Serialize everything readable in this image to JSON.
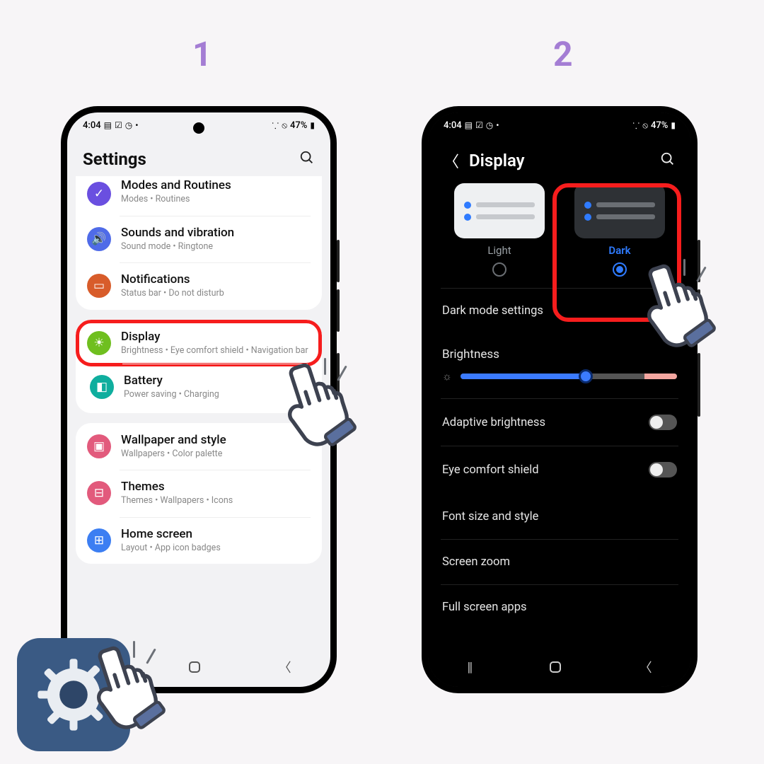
{
  "steps": {
    "one": "1",
    "two": "2"
  },
  "status": {
    "time": "4:04",
    "battery": "47%"
  },
  "screen1": {
    "title": "Settings",
    "rows": [
      {
        "title": "Modes and Routines",
        "sub": "Modes  •  Routines",
        "color": "#6a4fe0",
        "glyph": "✓"
      },
      {
        "title": "Sounds and vibration",
        "sub": "Sound mode  •  Ringtone",
        "color": "#4f6be8",
        "glyph": "🔊"
      },
      {
        "title": "Notifications",
        "sub": "Status bar  •  Do not disturb",
        "color": "#d85c2a",
        "glyph": "▭"
      },
      {
        "title": "Display",
        "sub": "Brightness  •  Eye comfort shield  •  Navigation bar",
        "color": "#6fbf1f",
        "glyph": "☀"
      },
      {
        "title": "Battery",
        "sub": "Power saving  •  Charging",
        "color": "#0fae9e",
        "glyph": "◧"
      },
      {
        "title": "Wallpaper and style",
        "sub": "Wallpapers  •  Color palette",
        "color": "#e25a7c",
        "glyph": "▣"
      },
      {
        "title": "Themes",
        "sub": "Themes  •  Wallpapers  •  Icons",
        "color": "#e25a7c",
        "glyph": "⊟"
      },
      {
        "title": "Home screen",
        "sub": "Layout  •  App icon badges",
        "color": "#3c7ef2",
        "glyph": "⊞"
      }
    ]
  },
  "screen2": {
    "title": "Display",
    "light": "Light",
    "dark": "Dark",
    "darkmode": "Dark mode settings",
    "brightness": "Brightness",
    "adaptive": "Adaptive brightness",
    "eye": "Eye comfort shield",
    "font": "Font size and style",
    "zoom": "Screen zoom",
    "fullapps": "Full screen apps",
    "slider_pct": 58
  }
}
